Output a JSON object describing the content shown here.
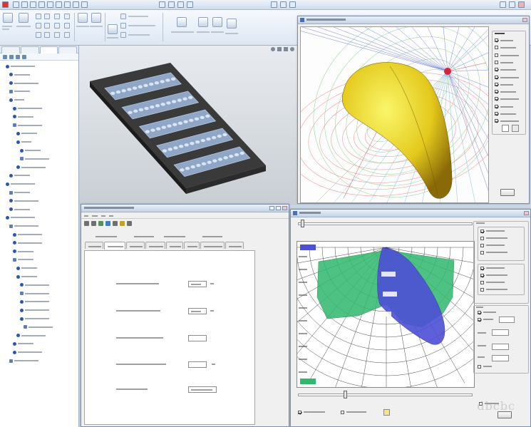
{
  "watermark": "dbcbc"
}
